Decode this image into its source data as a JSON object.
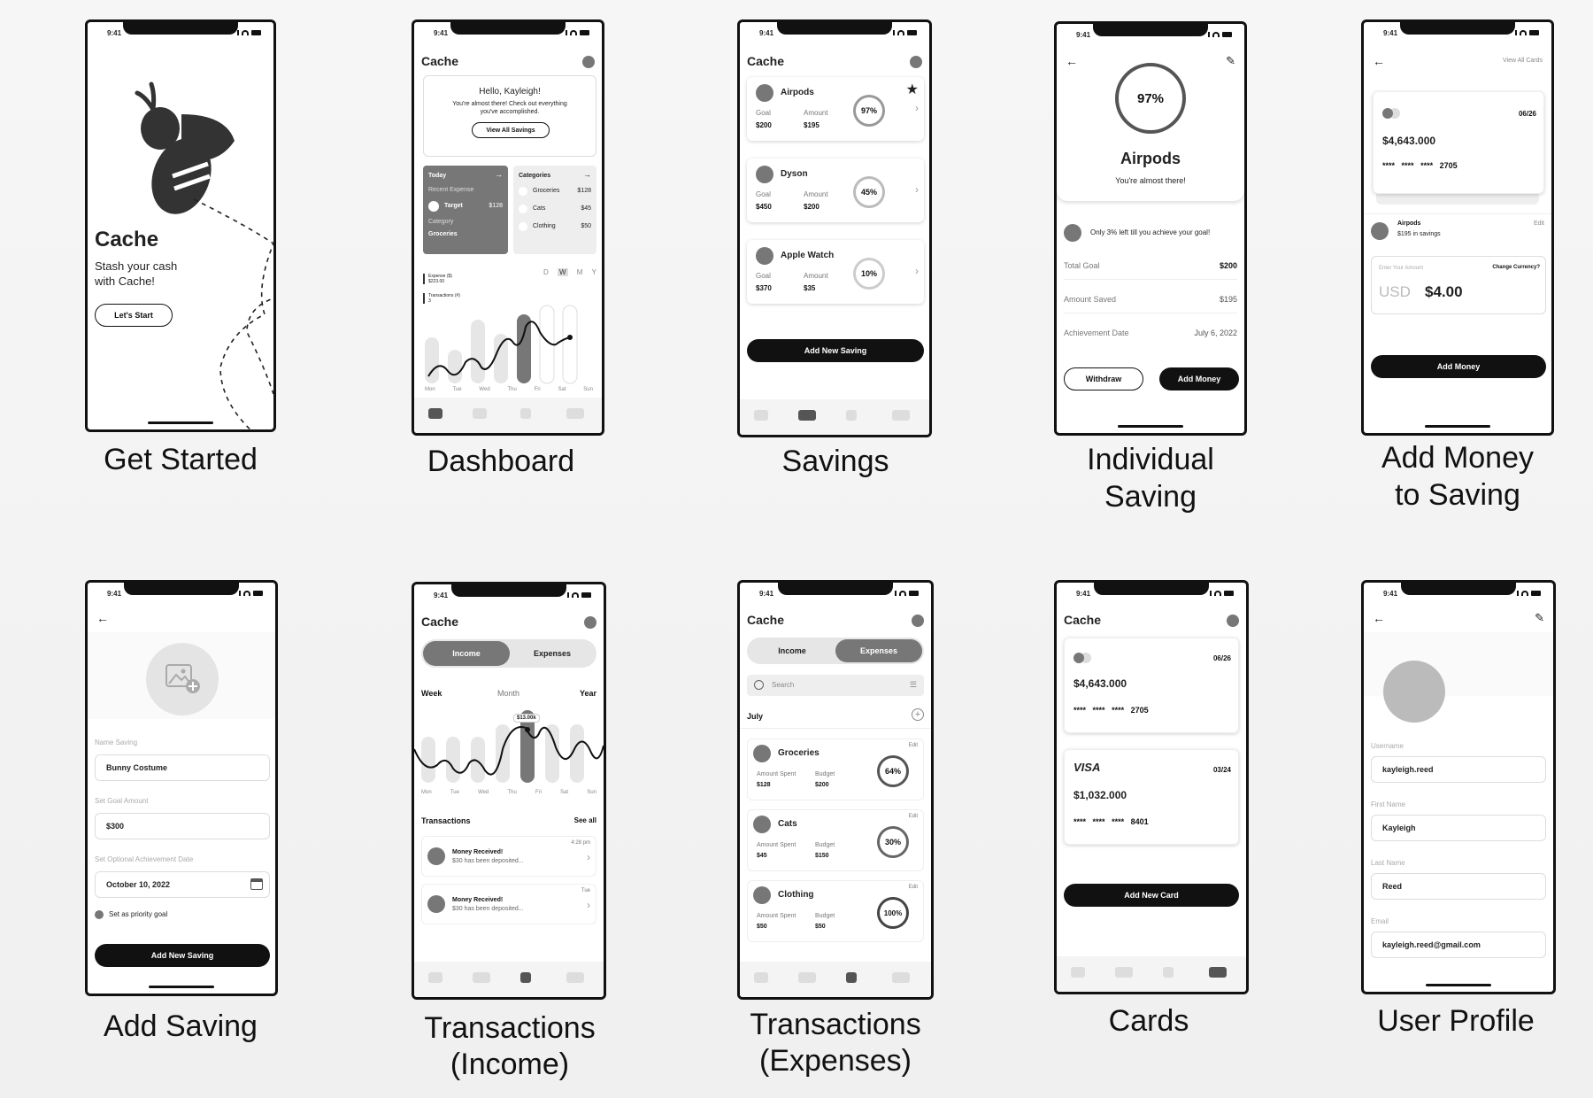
{
  "status_time": "9:41",
  "captions": {
    "get_started": "Get Started",
    "dashboard": "Dashboard",
    "savings": "Savings",
    "individual_1": "Individual",
    "individual_2": "Saving",
    "add_money_1": "Add Money",
    "add_money_2": "to Saving",
    "add_saving": "Add Saving",
    "tx_income_1": "Transactions",
    "tx_income_2": "(Income)",
    "tx_exp_1": "Transactions",
    "tx_exp_2": "(Expenses)",
    "cards": "Cards",
    "user_profile": "User Profile"
  },
  "app_name": "Cache",
  "get_started": {
    "title": "Cache",
    "tagline_1": "Stash your cash",
    "tagline_2": "with Cache!",
    "button": "Let's Start"
  },
  "dashboard": {
    "greeting": "Hello, Kayleigh!",
    "message_1": "You're almost there! Check out everything",
    "message_2": "you've accomplished.",
    "view_all": "View All Savings",
    "today": "Today",
    "recent_expense": "Recent Expense",
    "target": "Target",
    "target_amount": "$128",
    "category": "Category",
    "groceries": "Groceries",
    "categories_title": "Categories",
    "categories": [
      {
        "name": "Groceries",
        "amount": "$128"
      },
      {
        "name": "Cats",
        "amount": "$45"
      },
      {
        "name": "Clothing",
        "amount": "$50"
      }
    ],
    "periods": [
      "D",
      "W",
      "M",
      "Y"
    ],
    "legend_expense": "Expense ($)",
    "legend_expense_val": "$223.00",
    "legend_tx": "Transactions (#)",
    "legend_tx_val": "3",
    "days": [
      "Mon",
      "Tue",
      "Wed",
      "Thu",
      "Fri",
      "Sat",
      "Sun"
    ]
  },
  "savings": {
    "goal_label": "Goal",
    "amount_label": "Amount",
    "items": [
      {
        "name": "Airpods",
        "goal": "$200",
        "amount": "$195",
        "pct": "97%",
        "progress": 0.97
      },
      {
        "name": "Dyson",
        "goal": "$450",
        "amount": "$200",
        "pct": "45%",
        "progress": 0.45
      },
      {
        "name": "Apple Watch",
        "goal": "$370",
        "amount": "$35",
        "pct": "10%",
        "progress": 0.1
      }
    ],
    "add_button": "Add New Saving"
  },
  "individual": {
    "pct": "97%",
    "progress": 0.97,
    "name": "Airpods",
    "subtitle": "You're almost there!",
    "note": "Only 3% left till you achieve your goal!",
    "rows": [
      {
        "label": "Total Goal",
        "value": "$200"
      },
      {
        "label": "Amount Saved",
        "value": "$195"
      },
      {
        "label": "Achievement Date",
        "value": "July 6, 2022"
      }
    ],
    "withdraw": "Withdraw",
    "add_money": "Add Money"
  },
  "add_money": {
    "view_all": "View All Cards",
    "expiry": "06/26",
    "balance": "$4,643.000",
    "mask": "****",
    "last4": "2705",
    "saving_name": "Airpods",
    "saving_note": "$195 in savings",
    "edit": "Edit",
    "enter_amount": "Enter Your Amount",
    "change_currency": "Change Currency?",
    "currency": "USD",
    "amount": "$4.00",
    "button": "Add Money"
  },
  "add_saving": {
    "name_label": "Name Saving",
    "name_value": "Bunny Costume",
    "goal_label": "Set Goal Amount",
    "goal_value": "$300",
    "date_label": "Set Optional Achievement Date",
    "date_value": "October 10, 2022",
    "priority": "Set as priority goal",
    "button": "Add New Saving"
  },
  "tx_income": {
    "income": "Income",
    "expenses": "Expenses",
    "week": "Week",
    "month": "Month",
    "year": "Year",
    "tooltip": "$13.00k",
    "days": [
      "Mon",
      "Tue",
      "Wed",
      "Thu",
      "Fri",
      "Sat",
      "Sun"
    ],
    "transactions": "Transactions",
    "see_all": "See all",
    "items": [
      {
        "title": "Money Received!",
        "desc": "$30 has been deposited...",
        "time": "4:28 pm"
      },
      {
        "title": "Money Received!",
        "desc": "$30 has been deposited...",
        "time": "Tue"
      }
    ]
  },
  "tx_expenses": {
    "income": "Income",
    "expenses": "Expenses",
    "search": "Search",
    "month": "July",
    "spent_label": "Amount Spent",
    "budget_label": "Budget",
    "edit": "Edit",
    "items": [
      {
        "name": "Groceries",
        "spent": "$128",
        "budget": "$200",
        "pct": "64%"
      },
      {
        "name": "Cats",
        "spent": "$45",
        "budget": "$150",
        "pct": "30%"
      },
      {
        "name": "Clothing",
        "spent": "$50",
        "budget": "$50",
        "pct": "100%"
      }
    ]
  },
  "cards": {
    "card1": {
      "expiry": "06/26",
      "balance": "$4,643.000",
      "last4": "2705"
    },
    "card2": {
      "brand": "VISA",
      "expiry": "03/24",
      "balance": "$1,032.000",
      "last4": "8401"
    },
    "mask": "****",
    "button": "Add New Card"
  },
  "profile": {
    "fields": [
      {
        "label": "Username",
        "value": "kayleigh.reed"
      },
      {
        "label": "First Name",
        "value": "Kayleigh"
      },
      {
        "label": "Last Name",
        "value": "Reed"
      },
      {
        "label": "Email",
        "value": "kayleigh.reed@gmail.com"
      }
    ]
  }
}
